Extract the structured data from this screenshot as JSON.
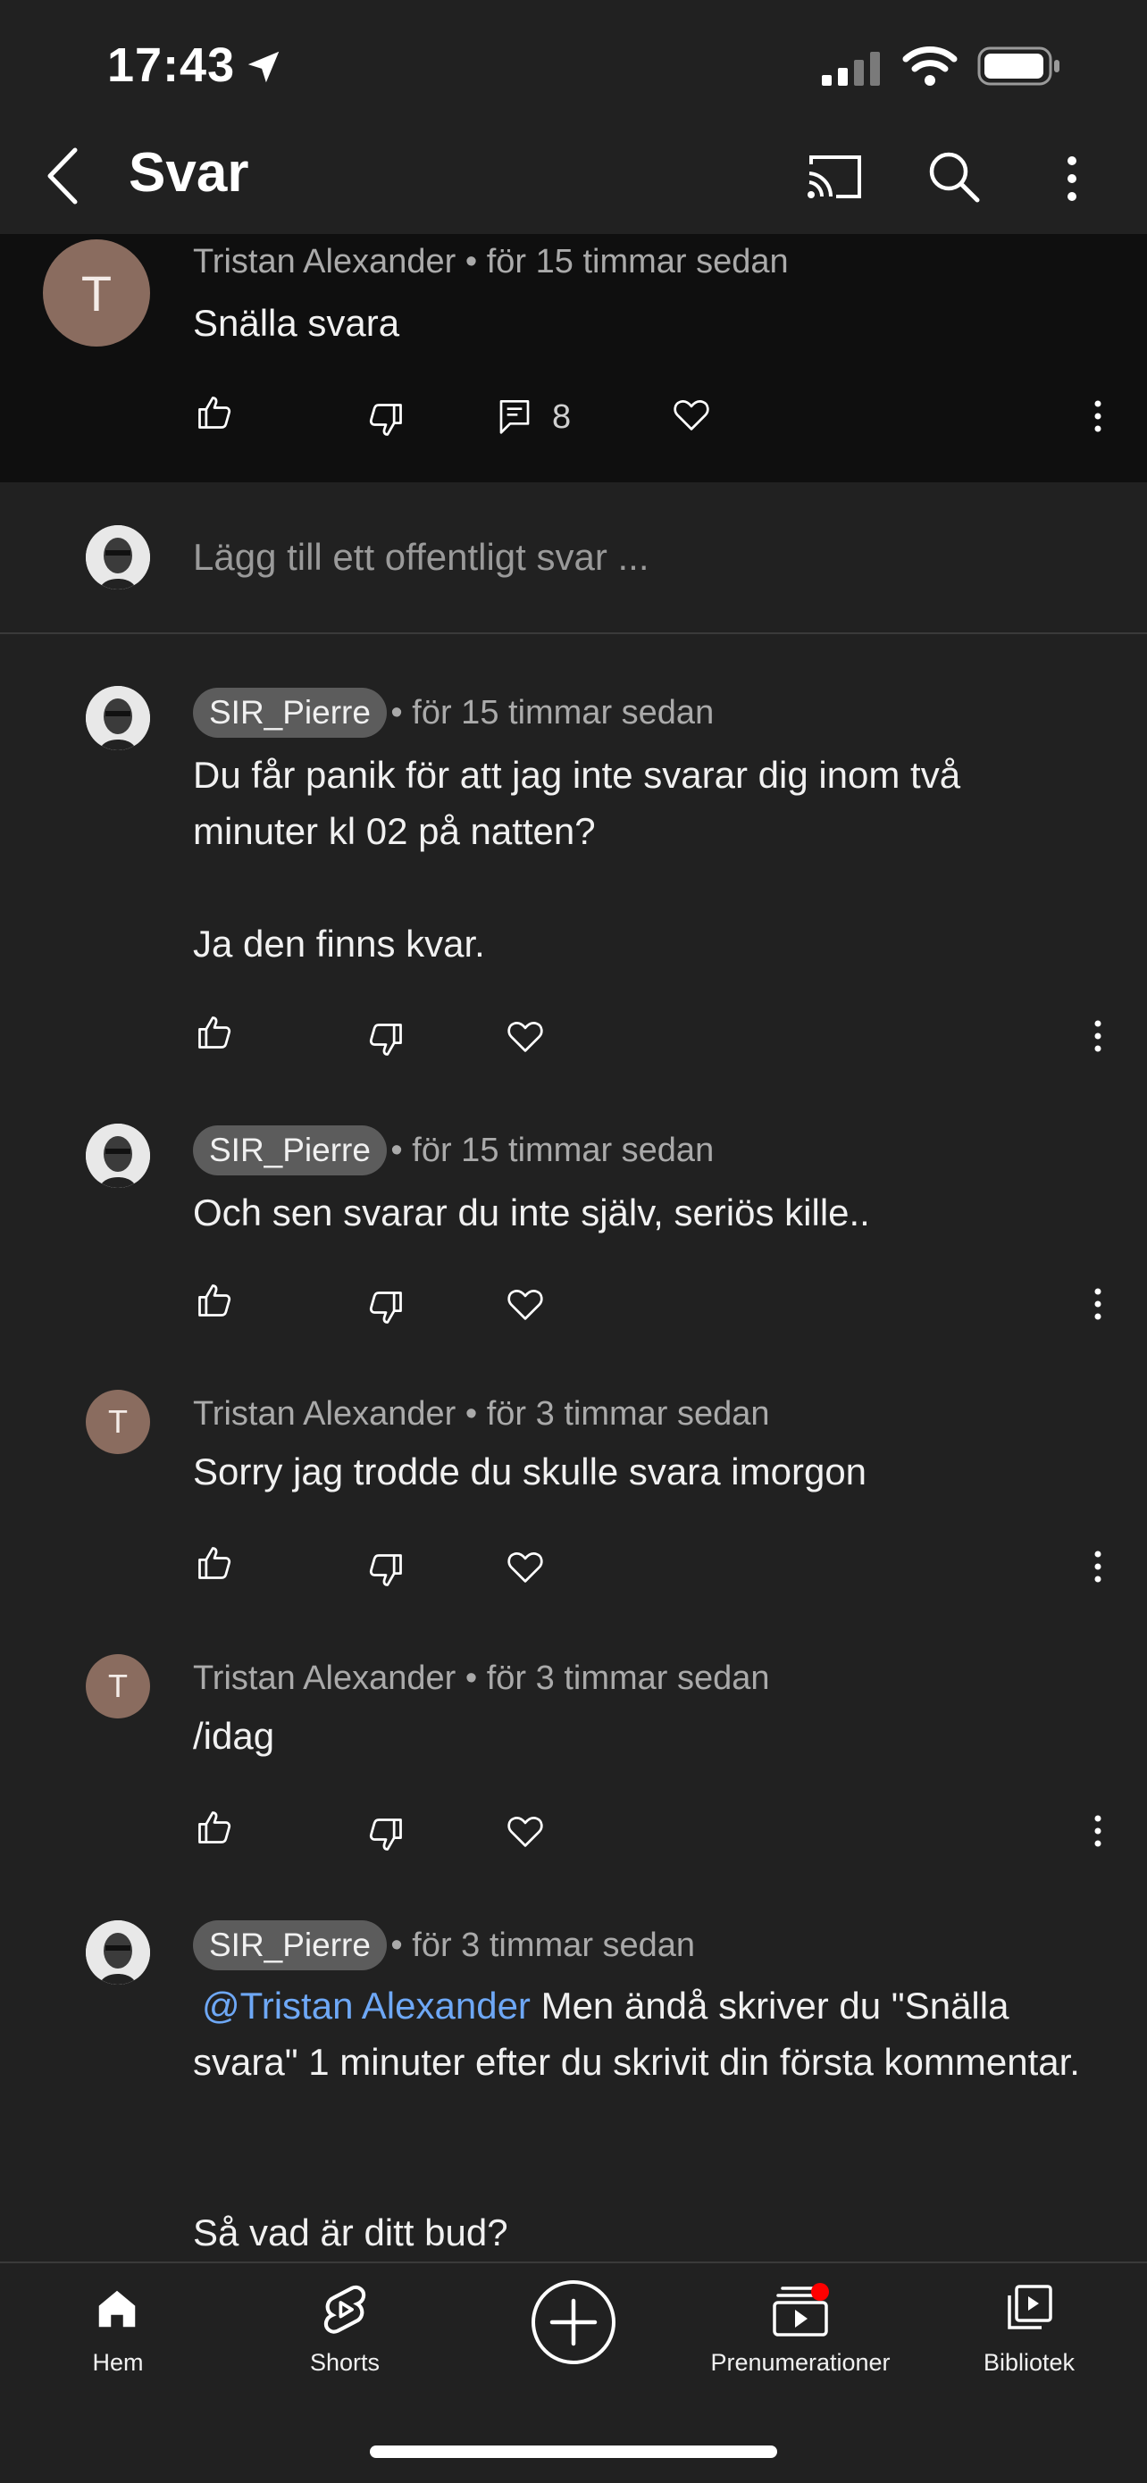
{
  "status_bar": {
    "time": "17:43"
  },
  "header": {
    "title": "Svar"
  },
  "parent_comment": {
    "author": "Tristan Alexander",
    "time": "för 15 timmar sedan",
    "avatar_letter": "T",
    "text": "Snälla svara",
    "reply_count": "8"
  },
  "reply_input": {
    "placeholder": "Lägg till ett offentligt svar ..."
  },
  "replies": [
    {
      "author": "SIR_Pierre",
      "time": "för 15 timmar sedan",
      "text": "Du får panik för att jag inte svarar dig inom två\nminuter kl 02 på natten?\n\nJa den finns kvar."
    },
    {
      "author": "SIR_Pierre",
      "time": "för 15 timmar sedan",
      "text": "Och sen svarar du inte själv, seriös kille.."
    },
    {
      "author": "Tristan Alexander",
      "avatar_letter": "T",
      "time": "för 3 timmar sedan",
      "text": "Sorry jag trodde du skulle svara imorgon"
    },
    {
      "author": "Tristan Alexander",
      "avatar_letter": "T",
      "time": "för 3 timmar sedan",
      "text": "/idag"
    },
    {
      "author": "SIR_Pierre",
      "time": "för 3 timmar sedan",
      "mention": "@Tristan Alexander",
      "text_after_mention": " Men ändå skriver du \"Snälla svara\" 1 minuter efter du skrivit din första kommentar.",
      "text_tail": "Så vad är ditt bud?"
    }
  ],
  "bottom_nav": {
    "items": [
      {
        "label": "Hem",
        "icon": "home-icon"
      },
      {
        "label": "Shorts",
        "icon": "shorts-icon"
      },
      {
        "label": "",
        "icon": "create-icon"
      },
      {
        "label": "Prenumerationer",
        "icon": "subscriptions-icon"
      },
      {
        "label": "Bibliotek",
        "icon": "library-icon"
      }
    ]
  },
  "colors": {
    "background": "#212121",
    "top_section": "#0f0f0f",
    "mention": "#6ea8f6",
    "notification_dot": "#ff0000"
  }
}
